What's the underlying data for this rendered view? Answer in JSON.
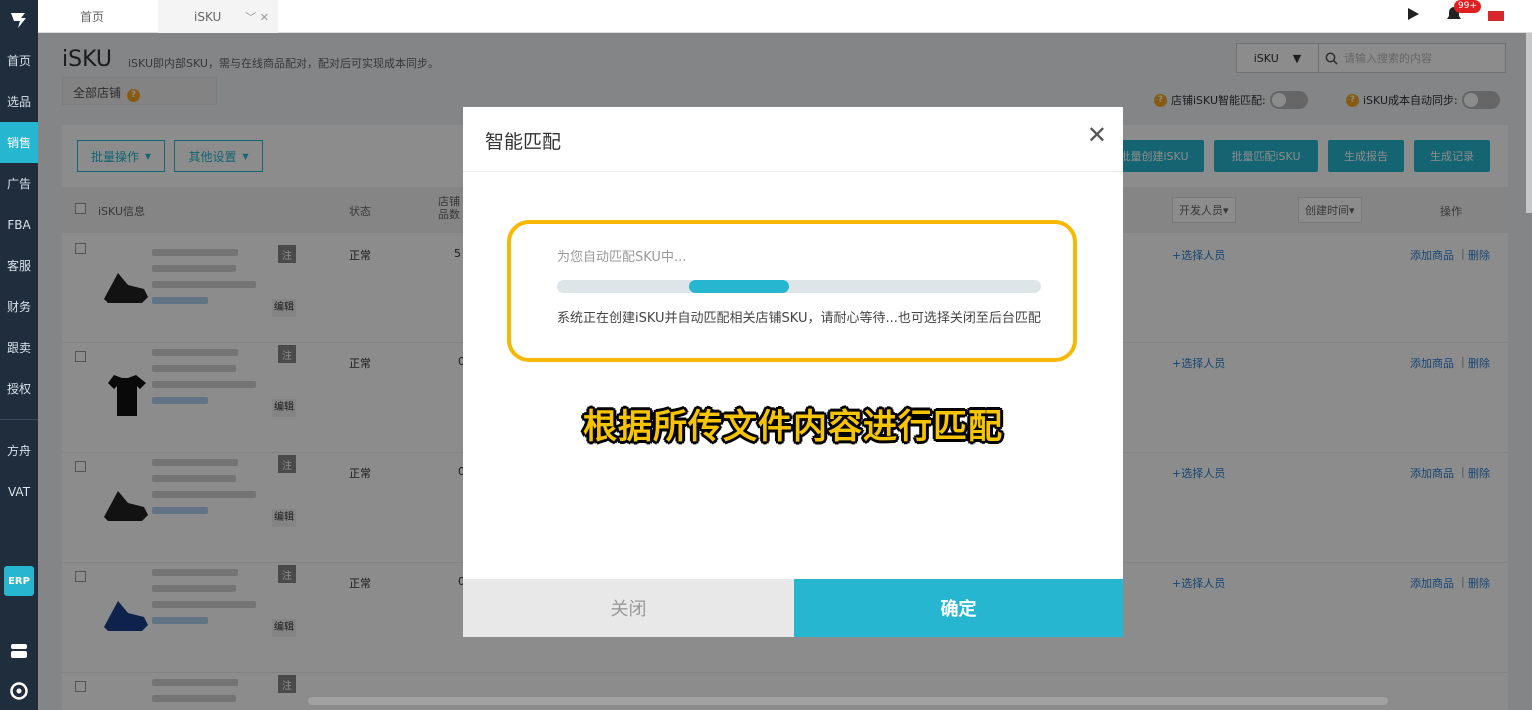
{
  "sidebar": {
    "items": [
      {
        "label": "首页"
      },
      {
        "label": "选品"
      },
      {
        "label": "销售"
      },
      {
        "label": "广告"
      },
      {
        "label": "FBA"
      },
      {
        "label": "客服"
      },
      {
        "label": "财务"
      },
      {
        "label": "跟卖"
      },
      {
        "label": "授权"
      },
      {
        "label": "方舟"
      },
      {
        "label": "VAT"
      }
    ],
    "active_index": 2,
    "erp_label": "ERP"
  },
  "topbar": {
    "tabs": [
      {
        "label": "首页"
      },
      {
        "label": "iSKU"
      }
    ],
    "notification_count": "99+"
  },
  "page": {
    "title": "iSKU",
    "description": "iSKU即内部SKU，需与在线商品配对，配对后可实现成本同步。",
    "store_filter": "全部店铺",
    "search": {
      "scope": "iSKU",
      "placeholder": "请输入搜索的内容"
    },
    "toggles": [
      {
        "label": "店铺iSKU智能匹配:"
      },
      {
        "label": "iSKU成本自动同步:"
      }
    ]
  },
  "toolbar": {
    "batch_ops": "批量操作",
    "other_settings": "其他设置",
    "batch_create": "批量创建iSKU",
    "batch_match": "批量匹配iSKU",
    "gen_report": "生成报告",
    "gen_record": "生成记录"
  },
  "table": {
    "headers": {
      "info": "iSKU信息",
      "status": "状态",
      "store_count": "店铺品数",
      "developer": "开发人员▾",
      "created": "创建时间▾",
      "actions": "操作"
    },
    "tag_label": "注",
    "edit_label": "编辑",
    "select_person": "+选择人员",
    "add_product": "添加商品",
    "delete": "删除",
    "rows": [
      {
        "status": "正常",
        "count": "5"
      },
      {
        "status": "正常",
        "count": "0"
      },
      {
        "status": "正常",
        "count": "0"
      },
      {
        "status": "正常",
        "count": "0"
      },
      {
        "status": "正常",
        "count": ""
      }
    ]
  },
  "modal": {
    "title": "智能匹配",
    "progress_label": "为您自动匹配SKU中...",
    "progress_fraction": 0.48,
    "description": "系统正在创建iSKU并自动匹配相关店铺SKU，请耐心等待...也可选择关闭至后台匹配",
    "caption": "根据所传文件内容进行匹配",
    "close_button": "关闭",
    "confirm_button": "确定"
  },
  "colors": {
    "accent": "#26b6d0",
    "sidebar_bg": "#1f2d3d",
    "highlight": "#f6b800"
  }
}
